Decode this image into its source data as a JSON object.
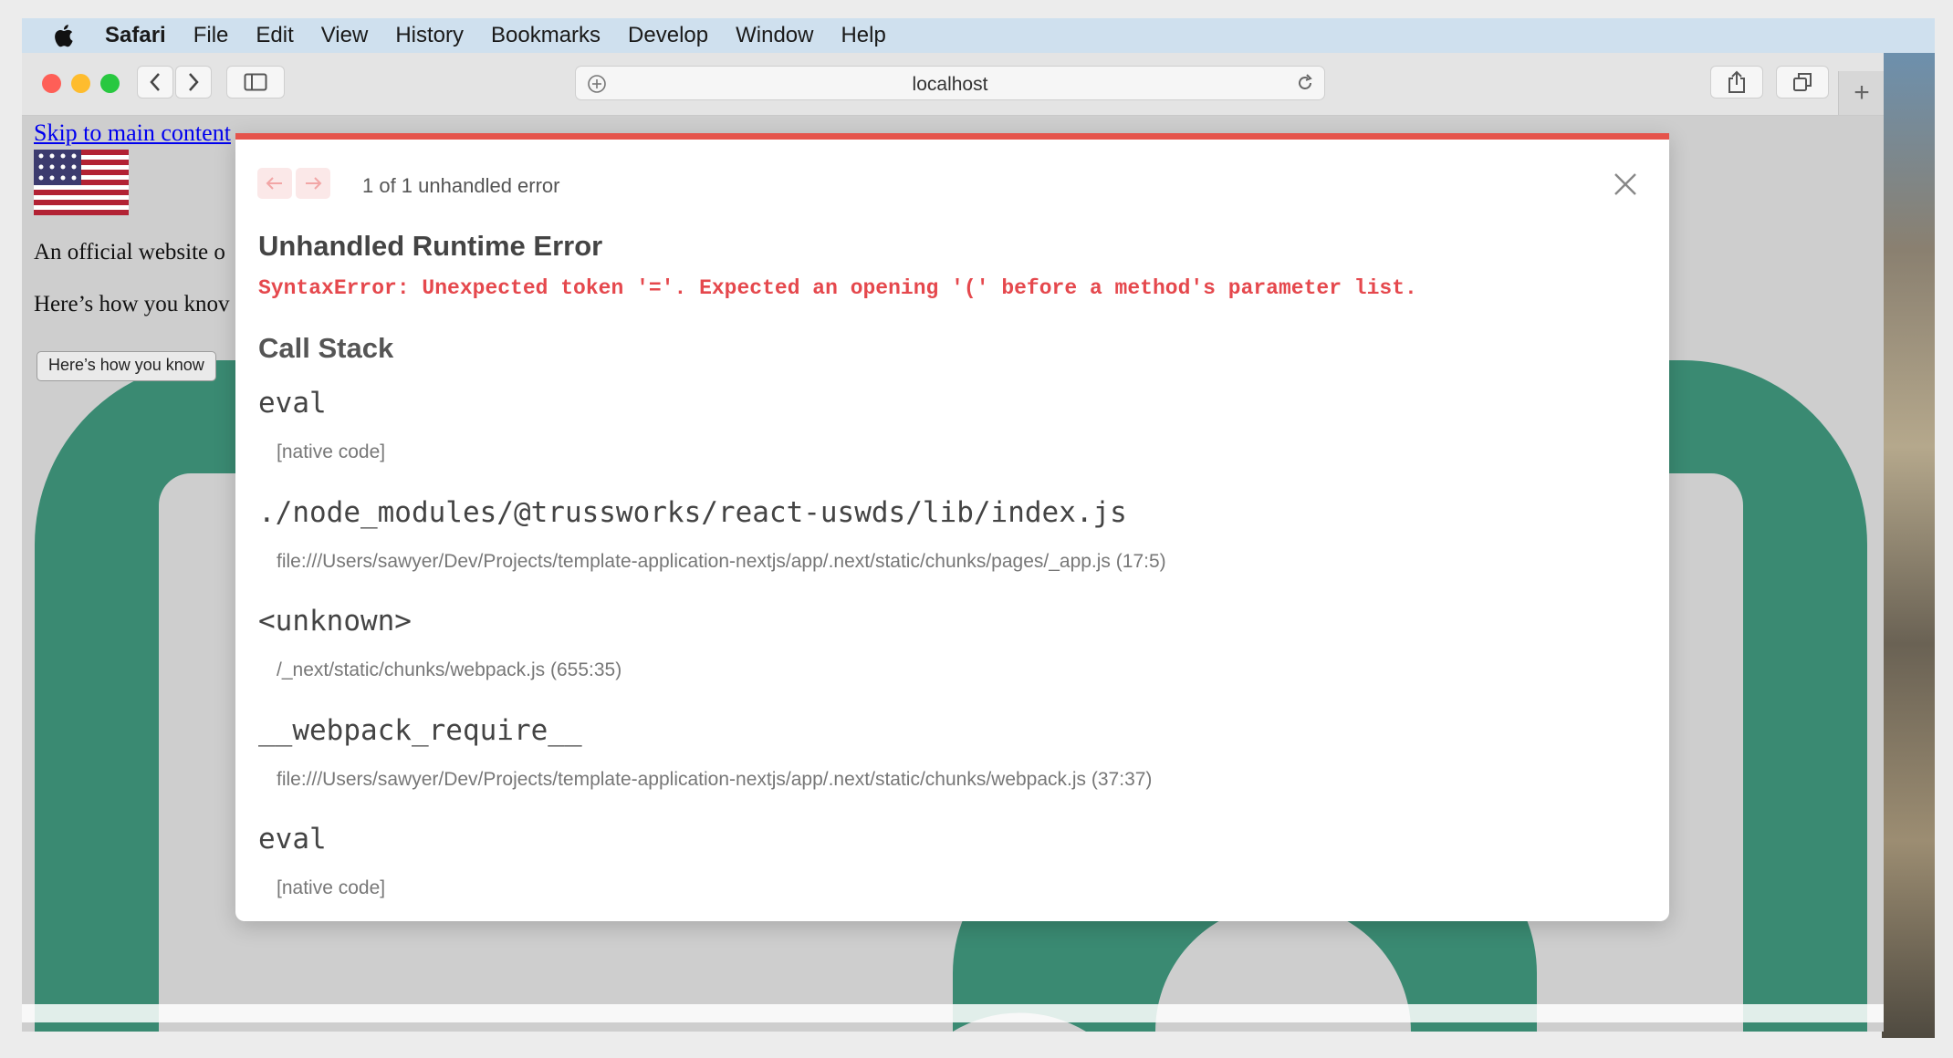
{
  "menubar": {
    "app_name": "Safari",
    "items": [
      "File",
      "Edit",
      "View",
      "History",
      "Bookmarks",
      "Develop",
      "Window",
      "Help"
    ]
  },
  "browser": {
    "url": "localhost",
    "new_tab": "+"
  },
  "page": {
    "skip_link": "Skip to main content",
    "official_text": "An official website o",
    "how_text": "Here’s how you knov",
    "how_button": "Here’s how you know"
  },
  "error_overlay": {
    "counter": "1 of 1 unhandled error",
    "title": "Unhandled Runtime Error",
    "message": "SyntaxError: Unexpected token '='. Expected an opening '(' before a method's parameter list.",
    "call_stack_title": "Call Stack",
    "frames": [
      {
        "fn": "eval",
        "location": "[native code]"
      },
      {
        "fn": "./node_modules/@trussworks/react-uswds/lib/index.js",
        "location": "file:///Users/sawyer/Dev/Projects/template-application-nextjs/app/.next/static/chunks/pages/_app.js (17:5)"
      },
      {
        "fn": "<unknown>",
        "location": "/_next/static/chunks/webpack.js (655:35)"
      },
      {
        "fn": "__webpack_require__",
        "location": "file:///Users/sawyer/Dev/Projects/template-application-nextjs/app/.next/static/chunks/webpack.js (37:37)"
      },
      {
        "fn": "eval",
        "location": "[native code]"
      }
    ]
  },
  "colors": {
    "error_red": "#e5484d",
    "overlay_top_border": "#e5534b",
    "deco_green": "#3a8a72"
  }
}
